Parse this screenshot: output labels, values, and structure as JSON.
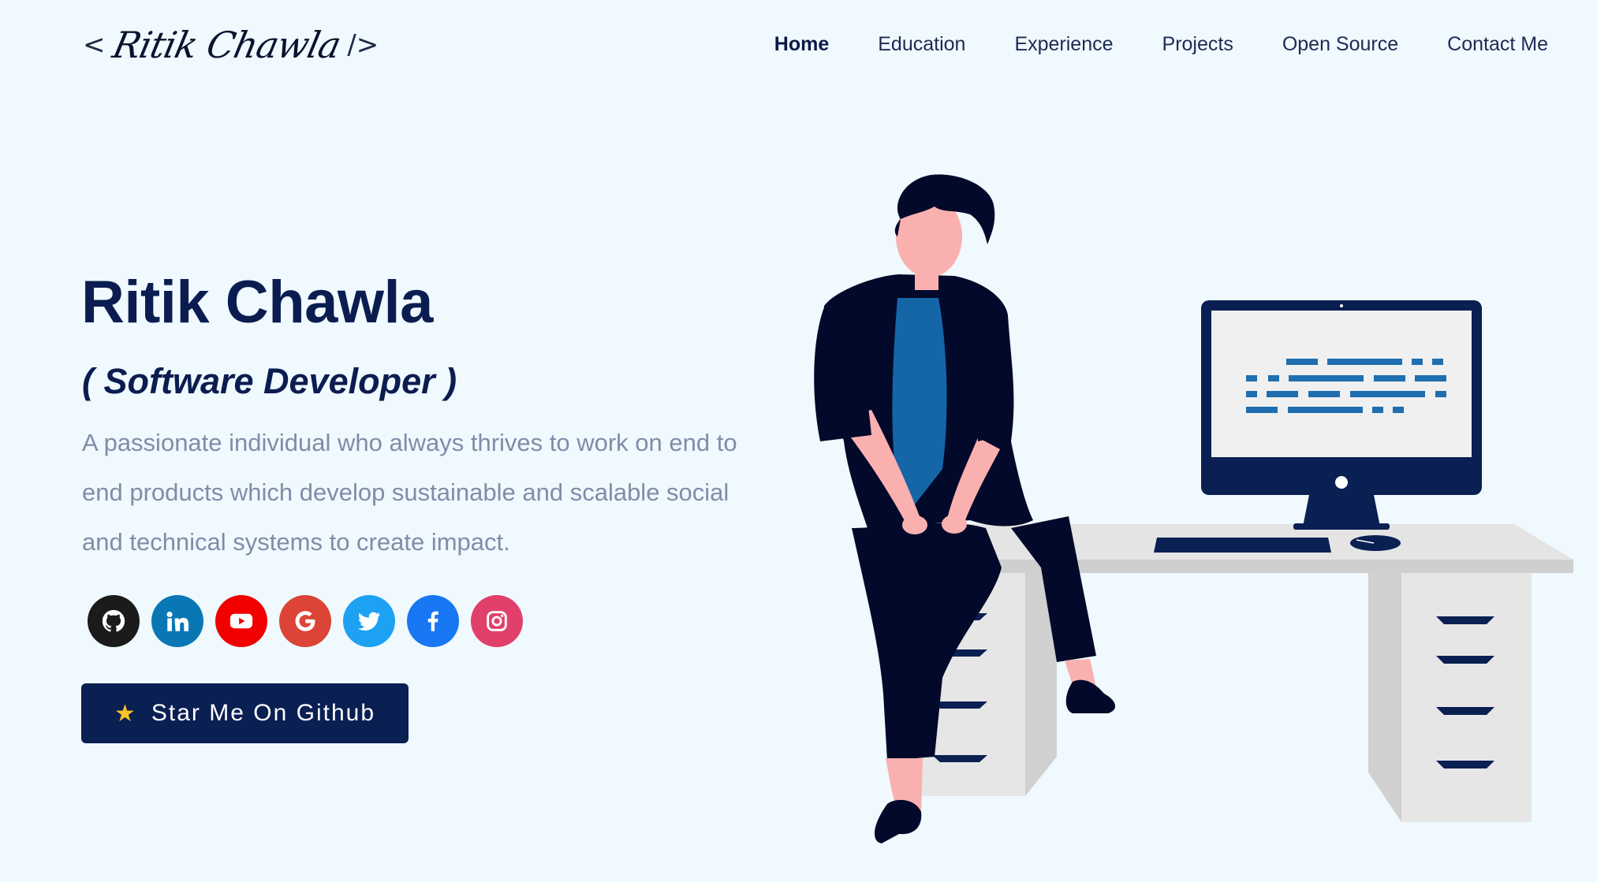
{
  "header": {
    "logo_open": "<",
    "logo_name": "Ritik Chawla",
    "logo_close": "/>",
    "nav": [
      {
        "label": "Home",
        "active": true
      },
      {
        "label": "Education"
      },
      {
        "label": "Experience"
      },
      {
        "label": "Projects"
      },
      {
        "label": "Open Source"
      },
      {
        "label": "Contact Me"
      }
    ]
  },
  "hero": {
    "name": "Ritik Chawla",
    "role": "( Software Developer )",
    "description": "A passionate individual who always thrives to work on end to end products which develop sustainable and scalable social and technical systems to create impact."
  },
  "socials": [
    {
      "name": "github-icon",
      "color": "#1b1b1b"
    },
    {
      "name": "linkedin-icon",
      "color": "#0a77b5"
    },
    {
      "name": "youtube-icon",
      "color": "#f20000"
    },
    {
      "name": "google-icon",
      "color": "#db4437"
    },
    {
      "name": "twitter-icon",
      "color": "#1da1f2"
    },
    {
      "name": "facebook-icon",
      "color": "#1877f2"
    },
    {
      "name": "instagram-icon",
      "color": "#e1406b"
    }
  ],
  "cta": {
    "label": "Star Me On Github",
    "icon": "star-icon"
  },
  "colors": {
    "background": "#eff9fe",
    "primary": "#0a1f52",
    "text_muted": "#7f8da8",
    "accent_star": "#f7c325"
  }
}
